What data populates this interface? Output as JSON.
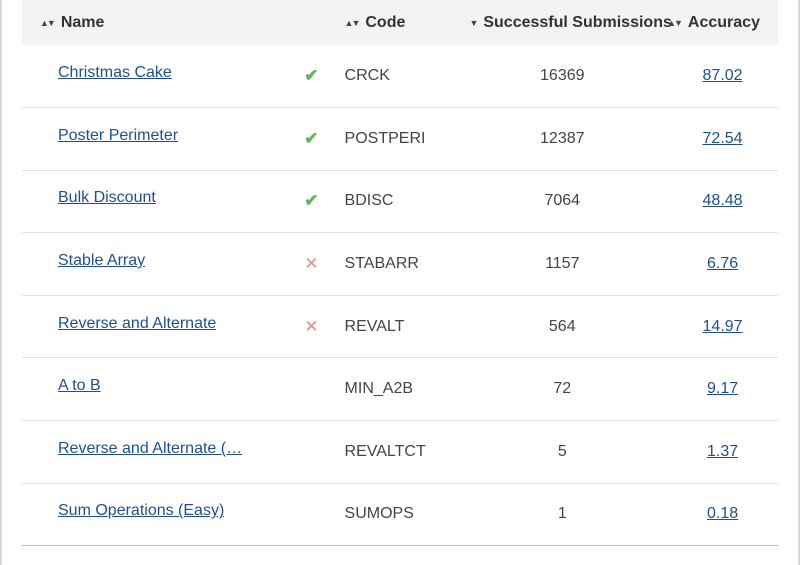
{
  "header": {
    "name": "Name",
    "code": "Code",
    "submissions": "Successful Submissions",
    "accuracy": "Accuracy"
  },
  "icons": {
    "sort": "sort-updown-icon",
    "sort_desc": "sort-desc-icon",
    "solved": "check-icon",
    "wrong": "cross-icon"
  },
  "colors": {
    "link": "#1e4f96",
    "check": "#5cb85c",
    "cross": "#e88c8c",
    "header_bg": "#f3f3f3"
  },
  "rows": [
    {
      "name": "Christmas Cake",
      "status": "solved",
      "code": "CRCK",
      "submissions": "16369",
      "accuracy": "87.02"
    },
    {
      "name": "Poster Perimeter",
      "status": "solved",
      "code": "POSTPERI",
      "submissions": "12387",
      "accuracy": "72.54"
    },
    {
      "name": "Bulk Discount",
      "status": "solved",
      "code": "BDISC",
      "submissions": "7064",
      "accuracy": "48.48"
    },
    {
      "name": "Stable Array",
      "status": "wrong",
      "code": "STABARR",
      "submissions": "1157",
      "accuracy": "6.76"
    },
    {
      "name": "Reverse and Alternate",
      "status": "wrong",
      "code": "REVALT",
      "submissions": "564",
      "accuracy": "14.97"
    },
    {
      "name": "A to B",
      "status": "",
      "code": "MIN_A2B",
      "submissions": "72",
      "accuracy": "9.17"
    },
    {
      "name": "Reverse and Alternate (…",
      "status": "",
      "code": "REVALTCT",
      "submissions": "5",
      "accuracy": "1.37"
    },
    {
      "name": "Sum Operations (Easy)",
      "status": "",
      "code": "SUMOPS",
      "submissions": "1",
      "accuracy": "0.18"
    }
  ]
}
